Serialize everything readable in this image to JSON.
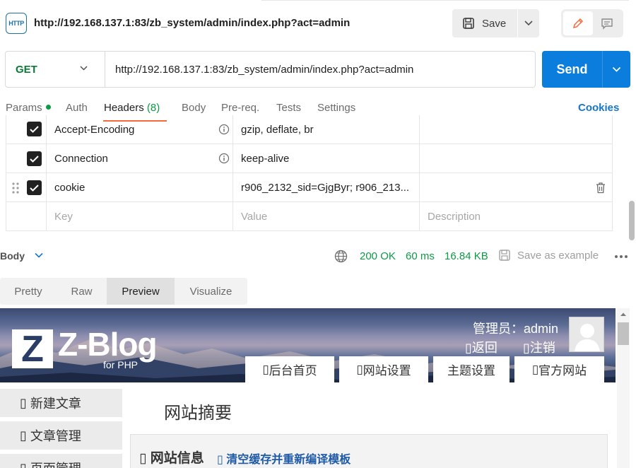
{
  "request": {
    "title": "http://192.168.137.1:83/zb_system/admin/index.php?act=admin",
    "method": "GET",
    "url": "http://192.168.137.1:83/zb_system/admin/index.php?act=admin",
    "save_label": "Save",
    "send_label": "Send",
    "http_icon_text": "HTTP"
  },
  "tabs": {
    "params": "Params",
    "auth": "Auth",
    "headers": "Headers",
    "headers_count": "(8)",
    "body": "Body",
    "prereq": "Pre-req.",
    "tests": "Tests",
    "settings": "Settings",
    "cookies": "Cookies"
  },
  "headers_table": {
    "rows": [
      {
        "key": "Accept-Encoding",
        "value": "gzip, deflate, br",
        "checked": true
      },
      {
        "key": "Connection",
        "value": "keep-alive",
        "checked": true
      },
      {
        "key": "cookie",
        "value": "r906_2132_sid=GjgByr; r906_213...",
        "checked": true
      }
    ],
    "placeholder_key": "Key",
    "placeholder_value": "Value",
    "placeholder_description": "Description"
  },
  "response": {
    "body_label": "Body",
    "status": "200 OK",
    "time": "60 ms",
    "size": "16.84 KB",
    "save_example": "Save as example",
    "view_tabs": [
      "Pretty",
      "Raw",
      "Preview",
      "Visualize"
    ],
    "active_view": "Preview"
  },
  "preview": {
    "logo_letter": "Z",
    "logo_text": "Z-Blog",
    "logo_sub": "for PHP",
    "admin_label": "管理员：admin",
    "back_link": "返回",
    "logout_link": "注销",
    "glyph": "▯",
    "nav_tabs": [
      "后台首页",
      "网站设置",
      "主题设置",
      "官方网站"
    ],
    "side_menu": [
      "新建文章",
      "文章管理",
      "页面管理"
    ],
    "page_title": "网站摘要",
    "panel_title": "网站信息",
    "panel_link": "清空缓存并重新编译模板"
  },
  "colors": {
    "send": "#0b7ddc",
    "success": "#0b9b45",
    "method": "#0b7a39",
    "tab_active": "#f26b3a",
    "link": "#1677c7"
  }
}
